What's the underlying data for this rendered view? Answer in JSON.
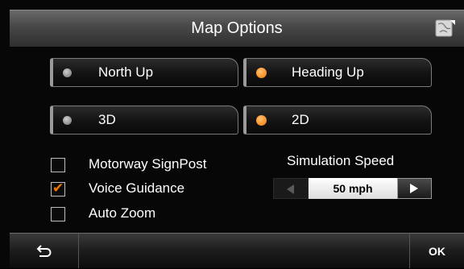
{
  "header": {
    "title": "Map Options",
    "map_icon": "map-icon"
  },
  "orientation": {
    "north_up": {
      "label": "North Up",
      "selected": false
    },
    "heading_up": {
      "label": "Heading Up",
      "selected": true
    }
  },
  "view_mode": {
    "three_d": {
      "label": "3D",
      "selected": false
    },
    "two_d": {
      "label": "2D",
      "selected": true
    }
  },
  "checkboxes": [
    {
      "label": "Motorway SignPost",
      "checked": false
    },
    {
      "label": "Voice Guidance",
      "checked": true
    },
    {
      "label": "Auto Zoom",
      "checked": false
    }
  ],
  "simulation": {
    "label": "Simulation Speed",
    "value": "50 mph"
  },
  "footer": {
    "back_icon": "back-arrow-icon",
    "ok_label": "OK"
  },
  "colors": {
    "accent": "#f07800",
    "text": "#ffffff",
    "background": "#070707"
  }
}
